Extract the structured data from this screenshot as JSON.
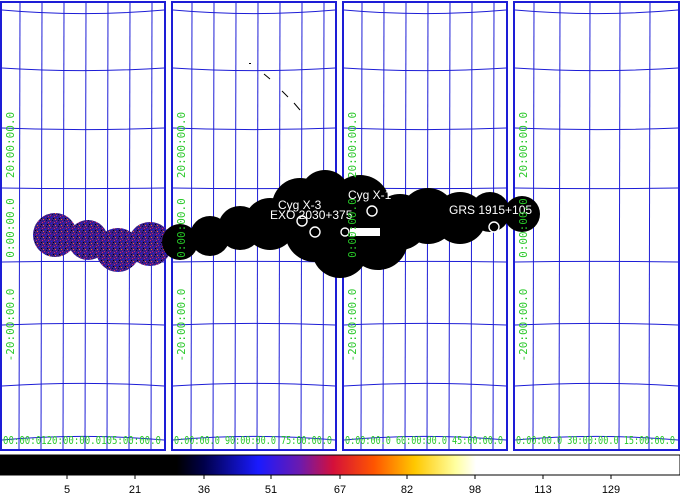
{
  "colors": {
    "grid": "#1d1dd6",
    "coord_text": "#28c828",
    "source_text": "#ffffff",
    "background": "#ffffff"
  },
  "icons": [
    "colorbar-gradient"
  ],
  "panels": [
    {
      "id": "p1",
      "dec_labels": [
        "20:00:00.0",
        "0:00:00.0",
        "-20:00:00.0"
      ],
      "ra_label": "00:00:0120:00:00.0105:00:00.0"
    },
    {
      "id": "p2",
      "dec_labels": [
        "20:00:00.0",
        "0:00:00.0",
        "-20:00:00.0"
      ],
      "ra_label": "0:00:00.0 90:00:00.0 75:00:00.0"
    },
    {
      "id": "p3",
      "dec_labels": [
        "20:00:00.0",
        "0:00:00.0",
        "-20:00:00.0"
      ],
      "ra_label": "0:00:00.0 60:00:00.0 45:00:00.0"
    },
    {
      "id": "p4",
      "dec_labels": [
        "20:00:00.0",
        "0:00:00.0",
        "-20:00:00.0"
      ],
      "ra_label": "0:00:00.0 30:00:00.0 15:00:00.0"
    }
  ],
  "sources": [
    {
      "name": "Cyg X-3"
    },
    {
      "name": "EXO 2030+375"
    },
    {
      "name": "Cyg X-1"
    },
    {
      "name": "GRS 1915+105"
    }
  ],
  "colorbar": {
    "ticks": [
      "5",
      "21",
      "36",
      "51",
      "67",
      "82",
      "98",
      "113",
      "129"
    ]
  }
}
